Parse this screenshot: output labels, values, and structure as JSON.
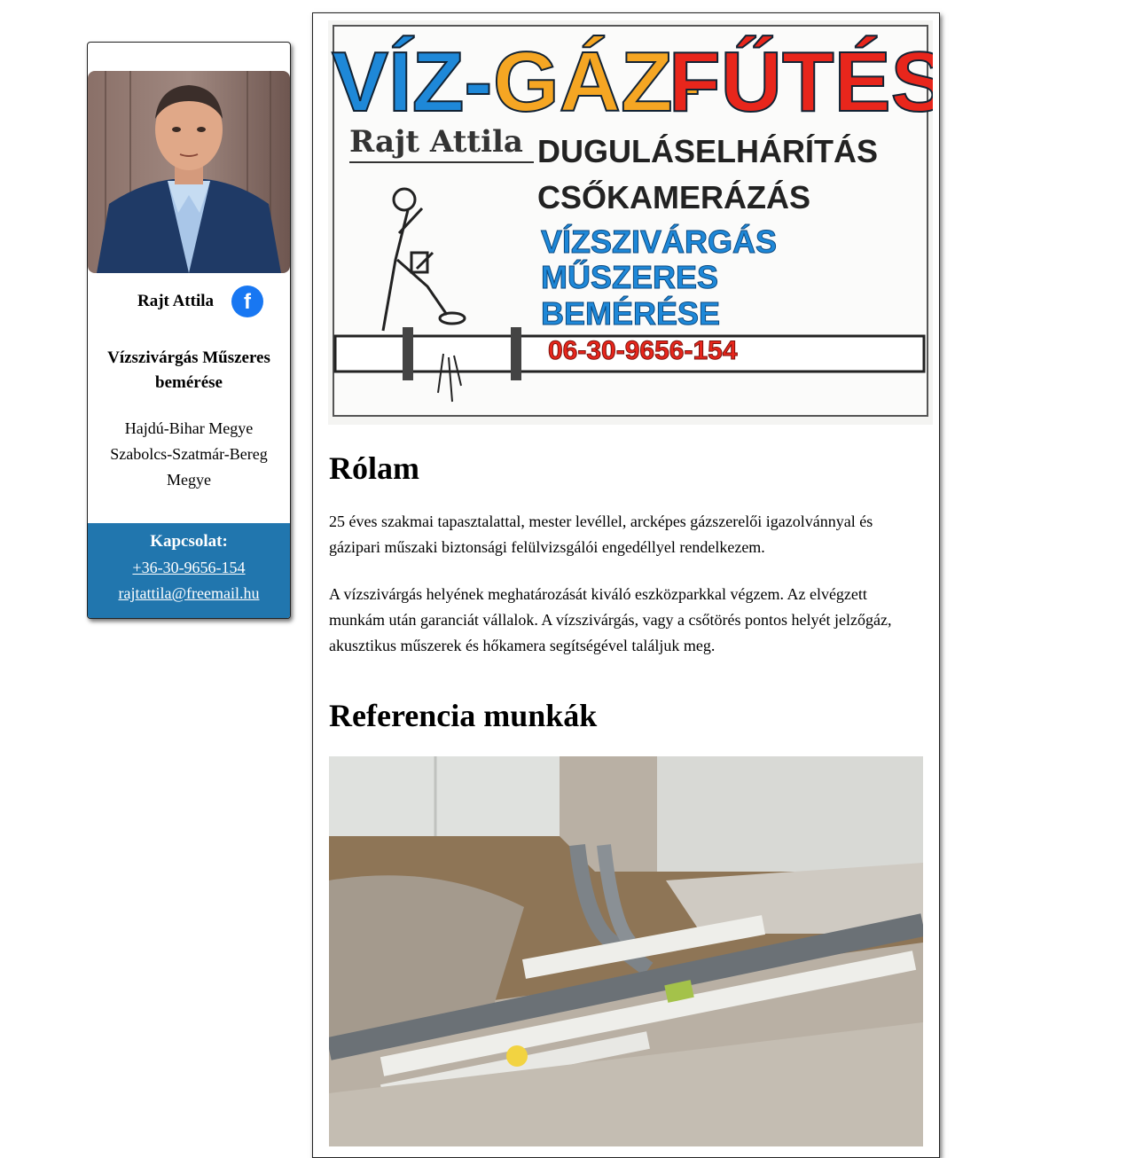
{
  "profile": {
    "name": "Rajt Attila",
    "title": "Vízszivárgás Műszeres bemérése",
    "regions": [
      "Hajdú-Bihar Megye",
      "Szabolcs-Szatmár-Bereg Megye"
    ],
    "facebook_icon": "facebook-icon"
  },
  "contact": {
    "label": "Kapcsolat:",
    "phone": "+36-30-9656-154",
    "email": "rajtattila@freemail.hu"
  },
  "banner": {
    "headline_1": "VÍZ-",
    "headline_2": "GÁZ-",
    "headline_3": "FŰTÉS",
    "owner": "Rajt Attila",
    "service_1": "DUGULÁSELHÁRÍTÁS",
    "service_2": "CSŐKAMERÁZÁS",
    "service_3": "VÍZSZIVÁRGÁS",
    "service_4": "MŰSZERES",
    "service_5": "BEMÉRÉSE",
    "phone": "06-30-9656-154"
  },
  "about": {
    "heading": "Rólam",
    "p1": "25 éves szakmai tapasztalattal, mester levéllel, arcképes gázszerelői igazolvánnyal és gázipari műszaki biztonsági felülvizsgálói engedéllyel rendelkezem.",
    "p2": "A vízszivárgás helyének meghatározását kiváló eszközparkkal végzem. Az elvégzett munkám után garanciát vállalok. A vízszivárgás, vagy a csőtörés pontos helyét jelzőgáz, akusztikus műszerek és hőkamera segítségével találjuk meg."
  },
  "references": {
    "heading": "Referencia munkák"
  },
  "colors": {
    "accent": "#2176AE",
    "facebook": "#1877F2",
    "viz_blue": "#1E88D8",
    "gaz_orange": "#F5A623",
    "futes_red": "#E8261C"
  }
}
